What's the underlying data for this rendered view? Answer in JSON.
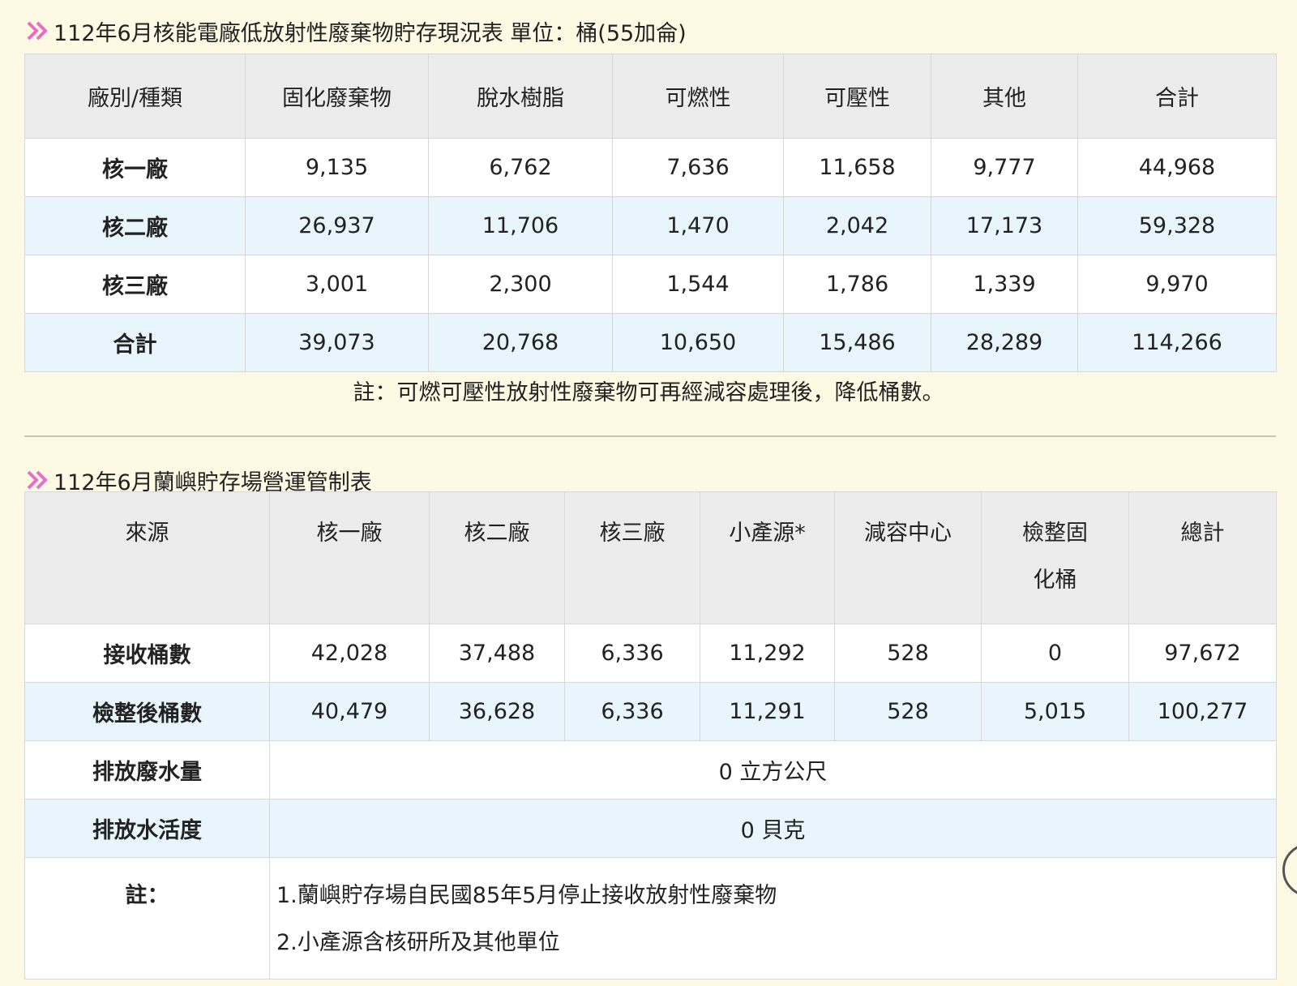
{
  "table1": {
    "title": "112年6月核能電廠低放射性廢棄物貯存現況表 單位：桶(55加侖)",
    "headers": [
      "廠別/種類",
      "固化廢棄物",
      "脫水樹脂",
      "可燃性",
      "可壓性",
      "其他",
      "合計"
    ],
    "rows": [
      [
        "核一廠",
        "9,135",
        "6,762",
        "7,636",
        "11,658",
        "9,777",
        "44,968"
      ],
      [
        "核二廠",
        "26,937",
        "11,706",
        "1,470",
        "2,042",
        "17,173",
        "59,328"
      ],
      [
        "核三廠",
        "3,001",
        "2,300",
        "1,544",
        "1,786",
        "1,339",
        "9,970"
      ],
      [
        "合計",
        "39,073",
        "20,768",
        "10,650",
        "15,486",
        "28,289",
        "114,266"
      ]
    ],
    "note": "註：可燃可壓性放射性廢棄物可再經減容處理後，降低桶數。"
  },
  "table2": {
    "title": "112年6月蘭嶼貯存場營運管制表",
    "headers": [
      "來源",
      "核一廠",
      "核二廠",
      "核三廠",
      "小產源*",
      "減容中心",
      "檢整固化桶",
      "總計"
    ],
    "rows": [
      [
        "接收桶數",
        "42,028",
        "37,488",
        "6,336",
        "11,292",
        "528",
        "0",
        "97,672"
      ],
      [
        "檢整後桶數",
        "40,479",
        "36,628",
        "6,336",
        "11,291",
        "528",
        "5,015",
        "100,277"
      ]
    ],
    "merged_rows": [
      [
        "排放廢水量",
        "0 立方公尺"
      ],
      [
        "排放水活度",
        "0 貝克"
      ]
    ],
    "notes_label": "註：",
    "notes": [
      "1.蘭嶼貯存場自民國85年5月停止接收放射性廢棄物",
      "2.小產源含核研所及其他單位"
    ]
  },
  "icons": {
    "title_marker": "double-chevron-right-icon"
  },
  "colors": {
    "page_background": "#fdf9e3",
    "header_background": "#ececec",
    "row_alt_background": "#e8f5fc",
    "chevron": "#e86ec8"
  }
}
